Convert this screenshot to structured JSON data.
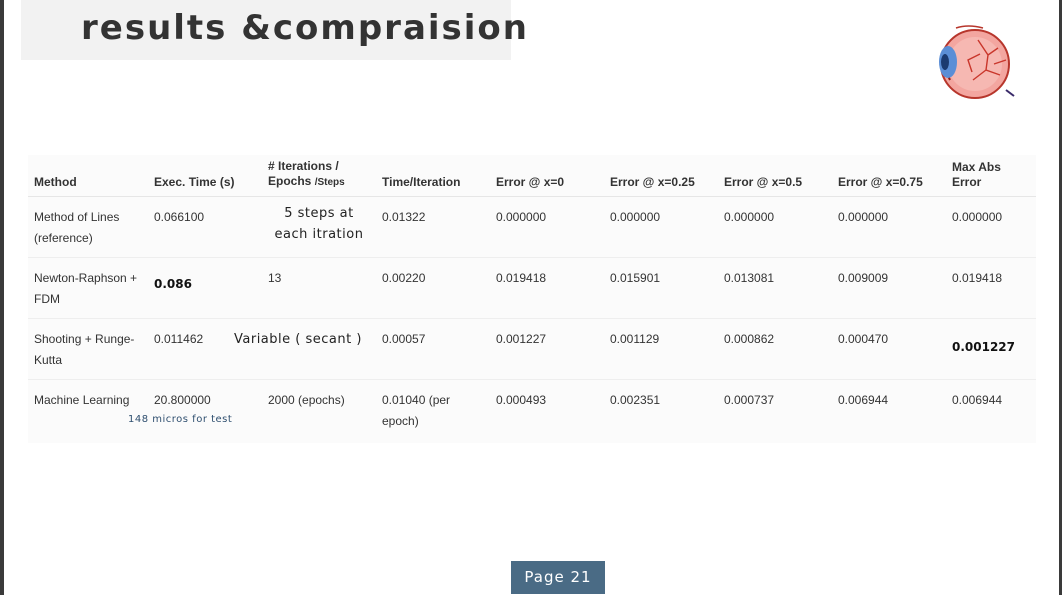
{
  "slide": {
    "title": "results &compraision",
    "page_label": "Page 21"
  },
  "icons": {
    "eye": "eye-anatomy-icon"
  },
  "table": {
    "headers": {
      "method": "Method",
      "exec_time": "Exec. Time (s)",
      "iterations_line1": "# Iterations /",
      "iterations_line2": "Epochs",
      "iterations_steps": "/Steps",
      "time_per_iter": "Time/Iteration",
      "err0": "Error @ x=0",
      "err025": "Error @ x=0.25",
      "err05": "Error @ x=0.5",
      "err075": "Error @ x=0.75",
      "max_err": "Max Abs Error"
    },
    "rows": [
      {
        "method": "Method of Lines (reference)",
        "exec_time": "0.066100",
        "iterations": "5 steps at each itration",
        "time_per_iter": "0.01322",
        "err0": "0.000000",
        "err025": "0.000000",
        "err05": "0.000000",
        "err075": "0.000000",
        "max_err": "0.000000"
      },
      {
        "method": "Newton-Raphson + FDM",
        "exec_time": "0.086",
        "iterations": "13",
        "time_per_iter": "0.00220",
        "err0": "0.019418",
        "err025": "0.015901",
        "err05": "0.013081",
        "err075": "0.009009",
        "max_err": "0.019418"
      },
      {
        "method": "Shooting + Runge-Kutta",
        "exec_time": "0.011462",
        "iterations": "Variable ( secant )",
        "time_per_iter": "0.00057",
        "err0": "0.001227",
        "err025": "0.001129",
        "err05": "0.000862",
        "err075": "0.000470",
        "max_err": "0.001227"
      },
      {
        "method": "Machine Learning",
        "exec_time": "20.800000",
        "exec_note": "148 micros for test",
        "iterations": "2000 (epochs)",
        "time_per_iter": "0.01040 (per epoch)",
        "err0": "0.000493",
        "err025": "0.002351",
        "err05": "0.000737",
        "err075": "0.006944",
        "max_err": "0.006944"
      }
    ]
  }
}
